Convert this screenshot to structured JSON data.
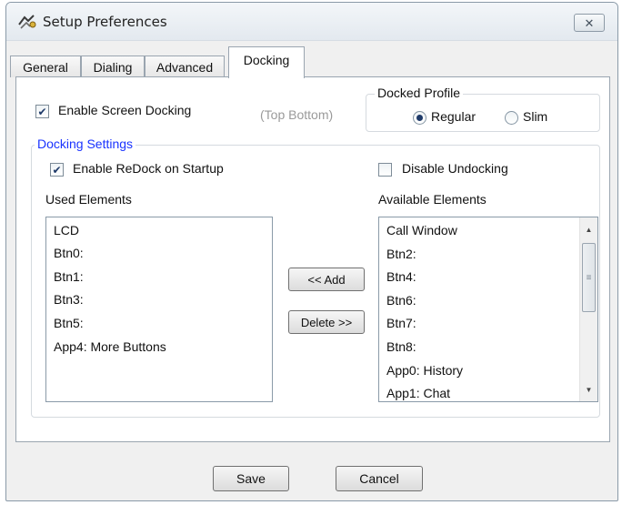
{
  "window": {
    "title": "Setup Preferences",
    "close_icon": "close-icon"
  },
  "tabs": [
    {
      "label": "General"
    },
    {
      "label": "Dialing"
    },
    {
      "label": "Advanced"
    },
    {
      "label": "Docking",
      "active": true
    }
  ],
  "docking": {
    "enable_screen_docking": {
      "label": "Enable Screen Docking",
      "checked": true
    },
    "position_hint": "(Top  Bottom)",
    "docked_profile": {
      "title": "Docked Profile",
      "options": [
        {
          "label": "Regular",
          "selected": true
        },
        {
          "label": "Slim",
          "selected": false
        }
      ]
    },
    "settings": {
      "title": "Docking Settings",
      "enable_redock": {
        "label": "Enable ReDock on Startup",
        "checked": true
      },
      "disable_undocking": {
        "label": "Disable Undocking",
        "checked": false
      },
      "used_label": "Used Elements",
      "available_label": "Available Elements",
      "used_items": [
        "LCD",
        "Btn0:",
        "Btn1:",
        "Btn3:",
        "Btn5:",
        "App4: More Buttons"
      ],
      "available_items": [
        "Call Window",
        "Btn2:",
        "Btn4:",
        "Btn6:",
        "Btn7:",
        "Btn8:",
        "App0: History",
        "App1: Chat"
      ],
      "add_label": "<< Add",
      "delete_label": "Delete >>"
    }
  },
  "footer": {
    "save_label": "Save",
    "cancel_label": "Cancel"
  },
  "colors": {
    "group_title": "#1a33ff",
    "check_mark": "#1f3a69"
  }
}
